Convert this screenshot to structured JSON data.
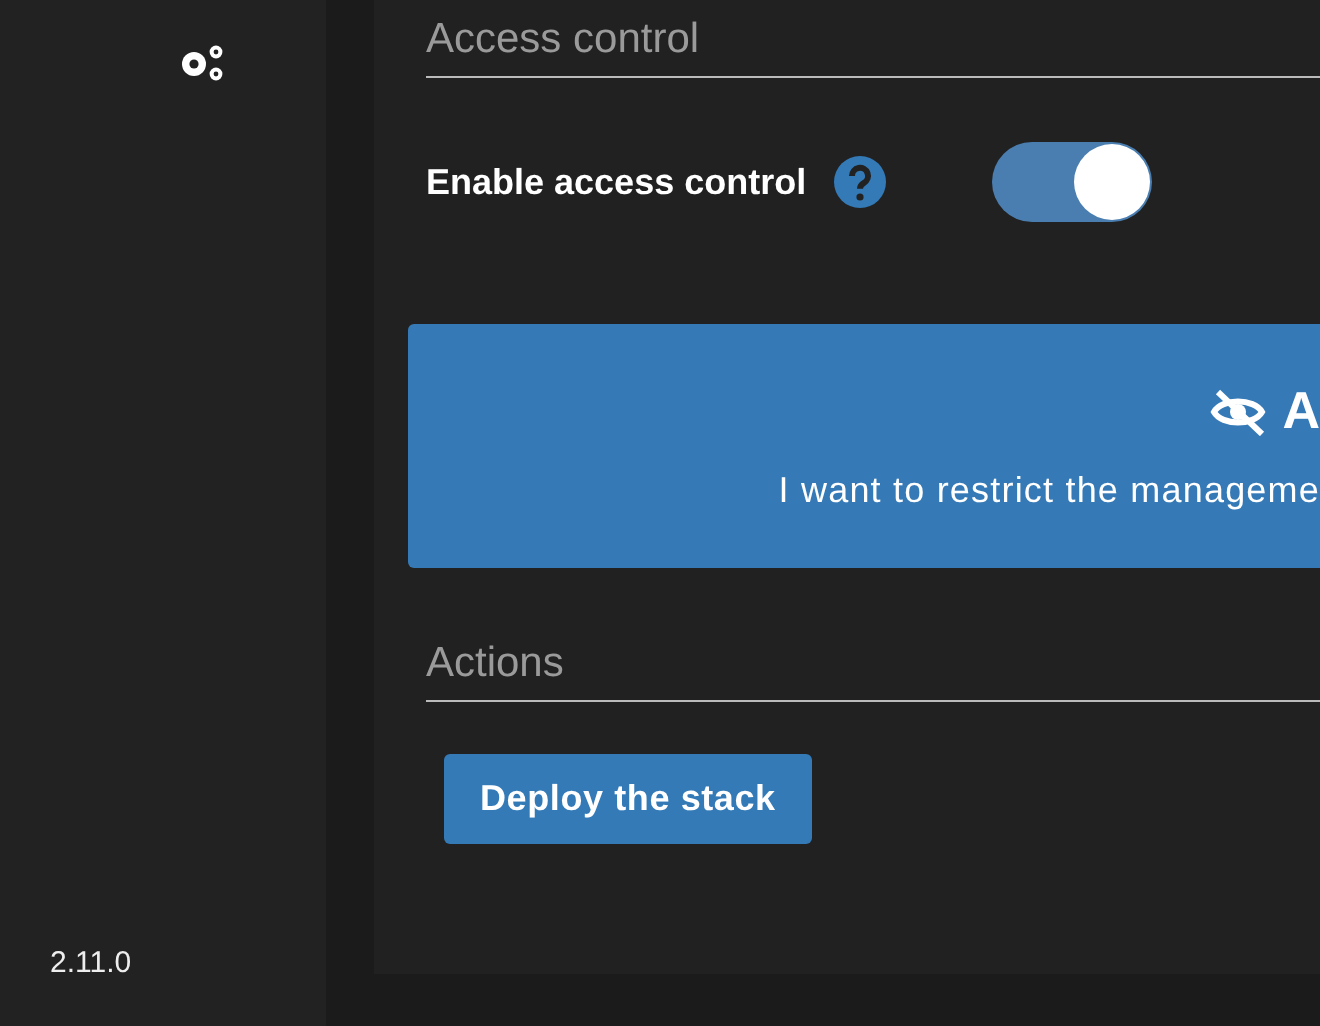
{
  "sidebar": {
    "version": "2.11.0"
  },
  "access_control": {
    "heading": "Access control",
    "toggle_label": "Enable access control",
    "enabled": true
  },
  "restriction_option": {
    "title": "A",
    "description": "I want to restrict the manageme",
    "selected": true
  },
  "actions": {
    "heading": "Actions",
    "buttons": [
      "Deploy the stack"
    ]
  }
}
